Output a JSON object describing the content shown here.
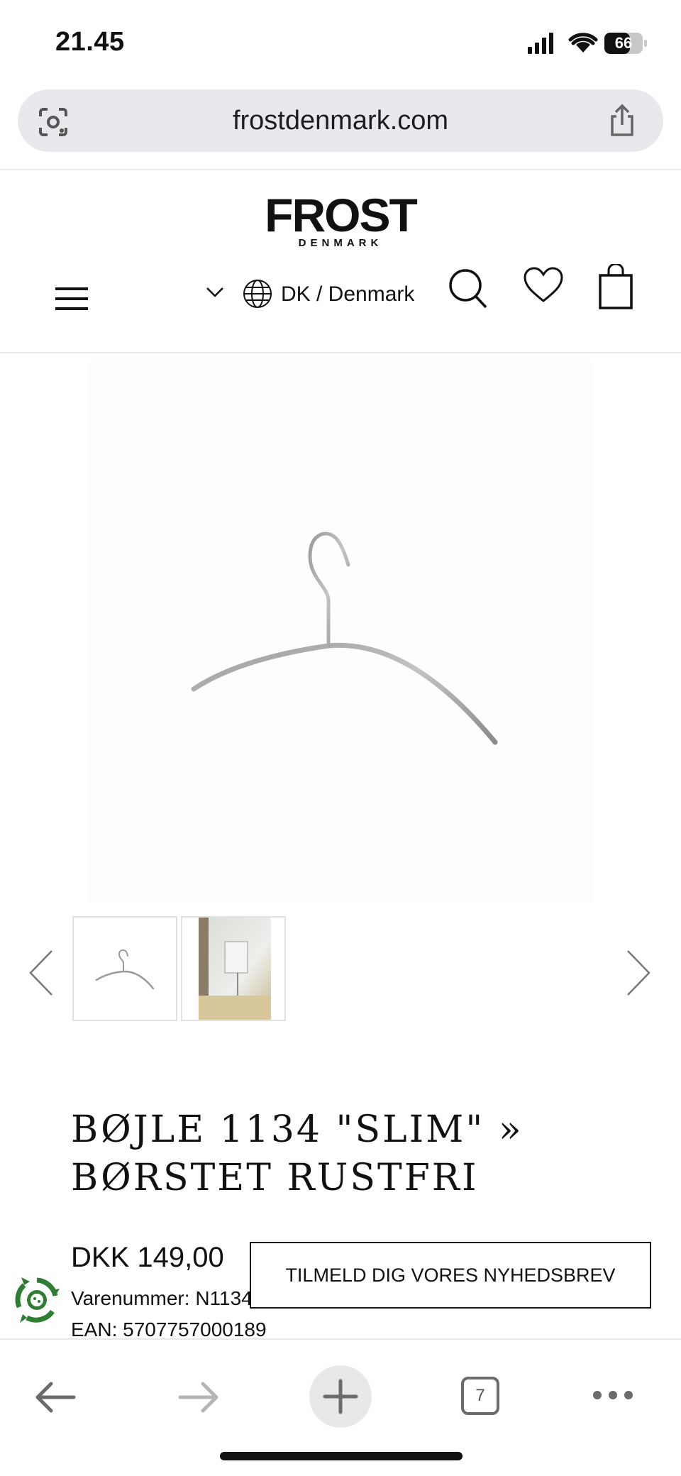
{
  "status_bar": {
    "time": "21.45",
    "battery": "66"
  },
  "browser": {
    "url": "frostdenmark.com",
    "tab_count": "7"
  },
  "header": {
    "logo_main": "FROST",
    "logo_sub": "DENMARK",
    "country": "DK / Denmark"
  },
  "product": {
    "title": "BØJLE 1134 \"SLIM\" » BØRSTET RUSTFRI",
    "price": "DKK 149,00",
    "sku_label": "Varenummer: N1134",
    "ean_label": "EAN: 5707757000189"
  },
  "newsletter": {
    "button_label": "TILMELD DIG VORES NYHEDSBREV"
  },
  "colors": {
    "eco_green": "#2e7d32",
    "url_bar_bg": "#e7e9ec"
  },
  "icons": [
    "lens-icon",
    "share-icon",
    "menu-icon",
    "chevron-down-icon",
    "globe-icon",
    "search-icon",
    "heart-icon",
    "bag-icon",
    "chevron-left-icon",
    "chevron-right-icon",
    "recycle-icon",
    "arrow-left-icon",
    "arrow-right-icon",
    "plus-icon",
    "more-icon"
  ]
}
